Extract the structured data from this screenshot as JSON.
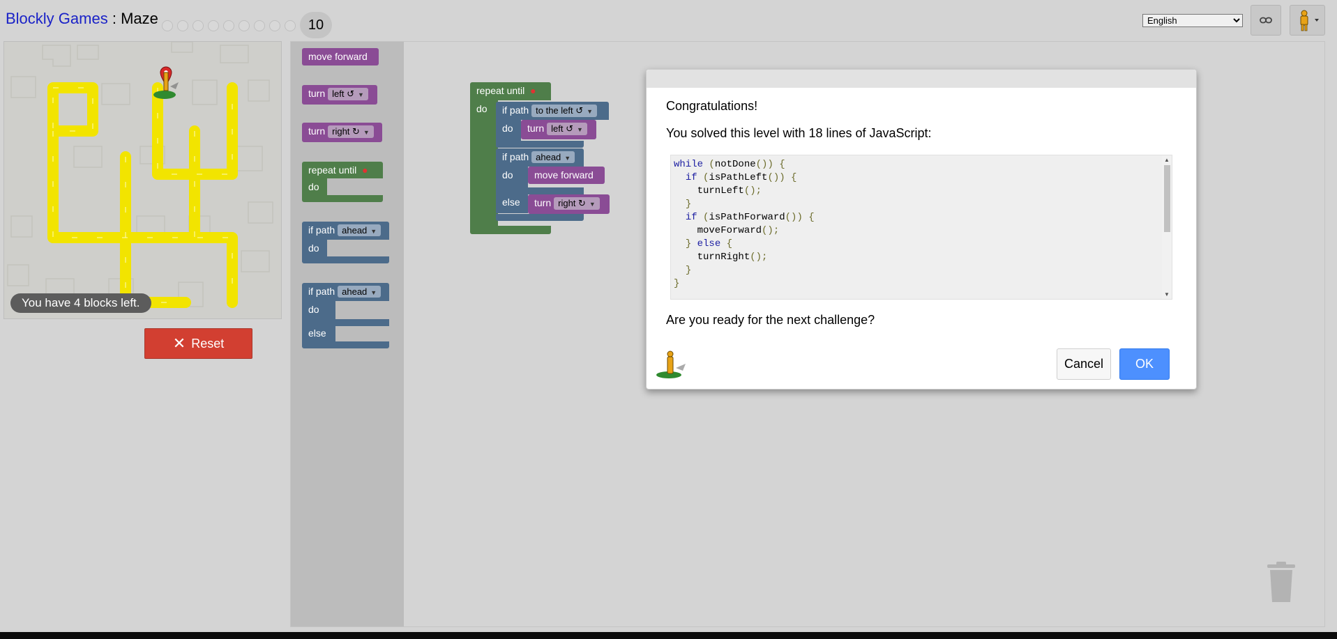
{
  "header": {
    "app_name": "Blockly Games",
    "separator": " : ",
    "game_name": "Maze",
    "current_level": "10",
    "language": "English"
  },
  "maze": {
    "capacity_prefix": "You have ",
    "capacity_count": "4",
    "capacity_suffix": " blocks left.",
    "reset_label": "Reset"
  },
  "toolbox": {
    "move_forward": "move forward",
    "turn": "turn",
    "left": "left ↺",
    "right": "right ↻",
    "repeat_until": "repeat until",
    "do": "do",
    "else": "else",
    "if_path": "if path",
    "ahead": "ahead"
  },
  "program": {
    "repeat_until": "repeat until",
    "do": "do",
    "if_path": "if path",
    "to_the_left": "to the left ↺",
    "turn": "turn",
    "left": "left ↺",
    "ahead": "ahead",
    "move_forward": "move forward",
    "else": "else",
    "right": "right ↻"
  },
  "dialog": {
    "congrats": "Congratulations!",
    "solved_text": "You solved this level with 18 lines of JavaScript:",
    "code_lines": [
      "while (notDone()) {",
      "  if (isPathLeft()) {",
      "    turnLeft();",
      "  }",
      "  if (isPathForward()) {",
      "    moveForward();",
      "  } else {",
      "    turnRight();",
      "  }",
      "}"
    ],
    "next_question": "Are you ready for the next challenge?",
    "cancel_label": "Cancel",
    "ok_label": "OK"
  },
  "colors": {
    "link": "#1a22c7",
    "reset": "#d23f31",
    "ok": "#4d90fe",
    "path": "#f2e400",
    "block_purple": "#8a4c95",
    "block_green": "#4f7e4a",
    "block_blue": "#4c6b8a"
  },
  "icons": {
    "link": "link-icon",
    "pegman": "pegman-icon",
    "trash": "trash-icon",
    "marker": "map-marker-icon",
    "reset": "close-icon"
  }
}
